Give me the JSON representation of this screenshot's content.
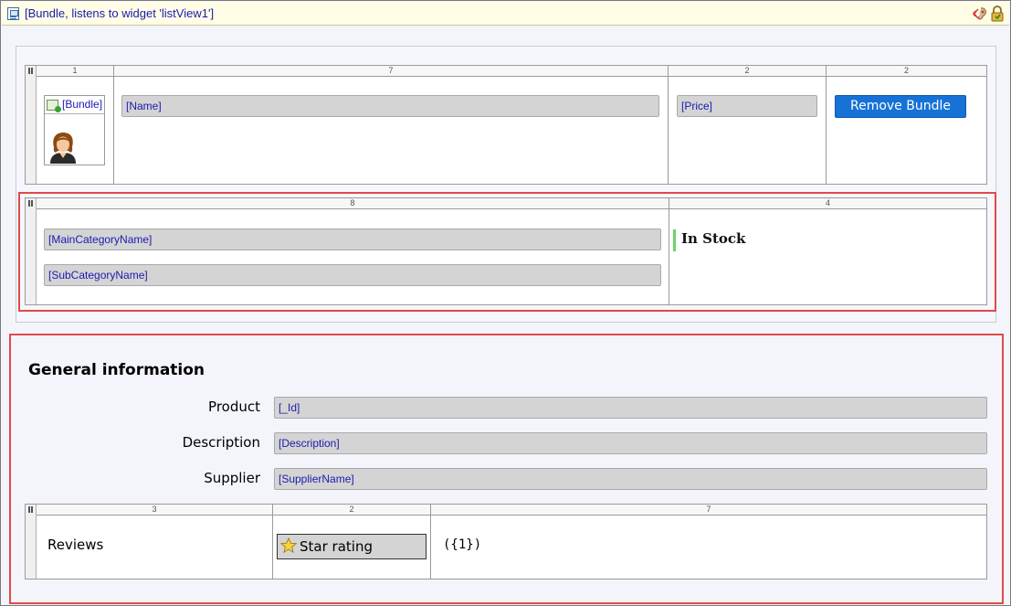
{
  "titlebar": {
    "title": "[Bundle, listens to widget 'listView1']",
    "icons": [
      "document-icon",
      "ear-icon",
      "lock-icon"
    ]
  },
  "top_grid": {
    "columns": [
      "1",
      "7",
      "2",
      "2"
    ],
    "bundle_label": "[Bundle]",
    "name_field": "[Name]",
    "price_field": "[Price]",
    "remove_button": "Remove Bundle"
  },
  "category_grid": {
    "columns": [
      "8",
      "4"
    ],
    "main_category": "[MainCategoryName]",
    "sub_category": "[SubCategoryName]",
    "stock_status": "In Stock"
  },
  "general": {
    "title": "General information",
    "rows": [
      {
        "label": "Product",
        "value": "[_Id]"
      },
      {
        "label": "Description",
        "value": "[Description]"
      },
      {
        "label": "Supplier",
        "value": "[SupplierName]"
      }
    ]
  },
  "reviews_grid": {
    "columns": [
      "3",
      "2",
      "7"
    ],
    "label": "Reviews",
    "rating_button": "Star rating",
    "value": "({1})"
  },
  "colors": {
    "accent": "#1672d6",
    "highlight": "#e04a4a",
    "binding_text": "#1a1ab0",
    "stock_bar": "#6bd46b"
  }
}
